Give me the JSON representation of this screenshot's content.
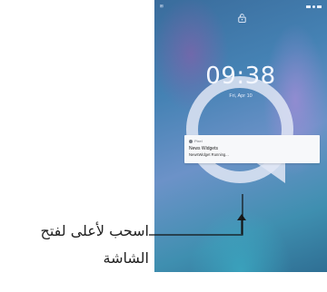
{
  "status_bar": {
    "left_text": "⊞",
    "icons": [
      "wifi-icon",
      "signal-icon",
      "battery-icon"
    ]
  },
  "lock_screen": {
    "time": "09:38",
    "date": "Fri, Apr 10"
  },
  "notification": {
    "app": "Pixel",
    "title": "News Widgets",
    "body": "NewsWidget Running..."
  },
  "caption": {
    "line1": "اسحب لأعلى لفتح",
    "line2": "الشاشة"
  },
  "colors": {
    "wallpaper_top": "#3a6c9c",
    "wallpaper_mid": "#6c92c8",
    "wallpaper_bottom": "#2f6f94",
    "callout_line": "#111111"
  }
}
